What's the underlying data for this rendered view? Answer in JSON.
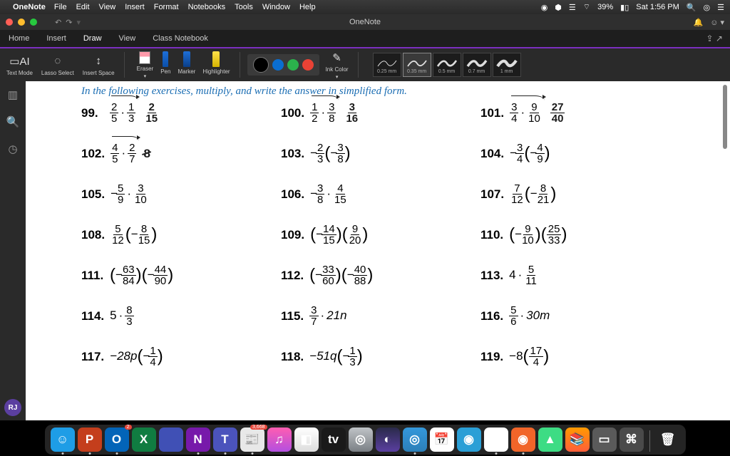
{
  "menubar": {
    "app": "OneNote",
    "items": [
      "File",
      "Edit",
      "View",
      "Insert",
      "Format",
      "Notebooks",
      "Tools",
      "Window",
      "Help"
    ],
    "battery": "39%",
    "time": "Sat 1:56 PM"
  },
  "titlebar": {
    "title": "OneNote"
  },
  "tabs": {
    "items": [
      "Home",
      "Insert",
      "Draw",
      "View",
      "Class Notebook"
    ],
    "active": 2
  },
  "ribbon": {
    "tools": [
      {
        "label": "Text Mode"
      },
      {
        "label": "Lasso Select"
      },
      {
        "label": "Insert Space"
      }
    ],
    "pens": [
      {
        "label": "Eraser"
      },
      {
        "label": "Pen"
      },
      {
        "label": "Marker"
      },
      {
        "label": "Highlighter"
      }
    ],
    "inkcolor": "Ink Color",
    "strokes": [
      "0.25 mm",
      "0.35 mm",
      "0.5 mm",
      "0.7 mm",
      "1 mm"
    ],
    "stroke_sel": 1
  },
  "avatar": "RJ",
  "page": {
    "instruction": "In the following exercises, multiply, and write the answer in simplified form.",
    "problems": [
      {
        "n": "99.",
        "expr": [
          {
            "t": "f",
            "a": "2",
            "b": "5"
          },
          {
            "t": "d"
          },
          {
            "t": "f",
            "a": "1",
            "b": "3"
          }
        ],
        "arrow": true,
        "ans": {
          "a": "2",
          "b": "15"
        }
      },
      {
        "n": "100.",
        "expr": [
          {
            "t": "f",
            "a": "1",
            "b": "2"
          },
          {
            "t": "d"
          },
          {
            "t": "f",
            "a": "3",
            "b": "8"
          }
        ],
        "arrow": true,
        "ans": {
          "a": "3",
          "b": "16"
        }
      },
      {
        "n": "101.",
        "expr": [
          {
            "t": "f",
            "a": "3",
            "b": "4"
          },
          {
            "t": "d"
          },
          {
            "t": "f",
            "a": "9",
            "b": "10"
          }
        ],
        "arrow": true,
        "ans": {
          "a": "27",
          "b": "40"
        }
      },
      {
        "n": "102.",
        "expr": [
          {
            "t": "f",
            "a": "4",
            "b": "5"
          },
          {
            "t": "d"
          },
          {
            "t": "f",
            "a": "2",
            "b": "7"
          }
        ],
        "arrow": true,
        "ans_cross": "8"
      },
      {
        "n": "103.",
        "expr": [
          {
            "t": "m"
          },
          {
            "t": "f",
            "a": "2",
            "b": "3"
          },
          {
            "t": "p",
            "inner": [
              {
                "t": "m"
              },
              {
                "t": "f",
                "a": "3",
                "b": "8"
              }
            ]
          }
        ]
      },
      {
        "n": "104.",
        "expr": [
          {
            "t": "m"
          },
          {
            "t": "f",
            "a": "3",
            "b": "4"
          },
          {
            "t": "p",
            "inner": [
              {
                "t": "m"
              },
              {
                "t": "f",
                "a": "4",
                "b": "9"
              }
            ]
          }
        ]
      },
      {
        "n": "105.",
        "expr": [
          {
            "t": "m"
          },
          {
            "t": "f",
            "a": "5",
            "b": "9"
          },
          {
            "t": "d"
          },
          {
            "t": "f",
            "a": "3",
            "b": "10"
          }
        ]
      },
      {
        "n": "106.",
        "expr": [
          {
            "t": "m"
          },
          {
            "t": "f",
            "a": "3",
            "b": "8"
          },
          {
            "t": "d"
          },
          {
            "t": "f",
            "a": "4",
            "b": "15"
          }
        ]
      },
      {
        "n": "107.",
        "expr": [
          {
            "t": "f",
            "a": "7",
            "b": "12"
          },
          {
            "t": "p",
            "inner": [
              {
                "t": "m"
              },
              {
                "t": "f",
                "a": "8",
                "b": "21"
              }
            ]
          }
        ]
      },
      {
        "n": "108.",
        "expr": [
          {
            "t": "f",
            "a": "5",
            "b": "12"
          },
          {
            "t": "p",
            "inner": [
              {
                "t": "m"
              },
              {
                "t": "f",
                "a": "8",
                "b": "15"
              }
            ]
          }
        ]
      },
      {
        "n": "109.",
        "expr": [
          {
            "t": "p",
            "inner": [
              {
                "t": "m"
              },
              {
                "t": "f",
                "a": "14",
                "b": "15"
              }
            ]
          },
          {
            "t": "p",
            "inner": [
              {
                "t": "f",
                "a": "9",
                "b": "20"
              }
            ]
          }
        ]
      },
      {
        "n": "110.",
        "expr": [
          {
            "t": "p",
            "inner": [
              {
                "t": "m"
              },
              {
                "t": "f",
                "a": "9",
                "b": "10"
              }
            ]
          },
          {
            "t": "p",
            "inner": [
              {
                "t": "f",
                "a": "25",
                "b": "33"
              }
            ]
          }
        ]
      },
      {
        "n": "111.",
        "expr": [
          {
            "t": "p",
            "inner": [
              {
                "t": "m"
              },
              {
                "t": "f",
                "a": "63",
                "b": "84"
              }
            ]
          },
          {
            "t": "p",
            "inner": [
              {
                "t": "m"
              },
              {
                "t": "f",
                "a": "44",
                "b": "90"
              }
            ]
          }
        ]
      },
      {
        "n": "112.",
        "expr": [
          {
            "t": "p",
            "inner": [
              {
                "t": "m"
              },
              {
                "t": "f",
                "a": "33",
                "b": "60"
              }
            ]
          },
          {
            "t": "p",
            "inner": [
              {
                "t": "m"
              },
              {
                "t": "f",
                "a": "40",
                "b": "88"
              }
            ]
          }
        ]
      },
      {
        "n": "113.",
        "expr": [
          {
            "t": "x",
            "v": "4"
          },
          {
            "t": "d"
          },
          {
            "t": "f",
            "a": "5",
            "b": "11"
          }
        ]
      },
      {
        "n": "114.",
        "expr": [
          {
            "t": "x",
            "v": "5"
          },
          {
            "t": "d"
          },
          {
            "t": "f",
            "a": "8",
            "b": "3"
          }
        ]
      },
      {
        "n": "115.",
        "expr": [
          {
            "t": "f",
            "a": "3",
            "b": "7"
          },
          {
            "t": "d"
          },
          {
            "t": "x",
            "v": "21n",
            "it": true
          }
        ]
      },
      {
        "n": "116.",
        "expr": [
          {
            "t": "f",
            "a": "5",
            "b": "6"
          },
          {
            "t": "d"
          },
          {
            "t": "x",
            "v": "30m",
            "it": true
          }
        ]
      },
      {
        "n": "117.",
        "expr": [
          {
            "t": "x",
            "v": "−28p",
            "it": true
          },
          {
            "t": "p",
            "inner": [
              {
                "t": "m"
              },
              {
                "t": "f",
                "a": "1",
                "b": "4"
              }
            ]
          }
        ]
      },
      {
        "n": "118.",
        "expr": [
          {
            "t": "x",
            "v": "−51q",
            "it": true
          },
          {
            "t": "p",
            "inner": [
              {
                "t": "m"
              },
              {
                "t": "f",
                "a": "1",
                "b": "3"
              }
            ]
          }
        ]
      },
      {
        "n": "119.",
        "expr": [
          {
            "t": "x",
            "v": "−8"
          },
          {
            "t": "p",
            "inner": [
              {
                "t": "f",
                "a": "17",
                "b": "4"
              }
            ]
          }
        ]
      }
    ]
  },
  "dock": {
    "icons": [
      {
        "bg": "#1e9de6",
        "ch": "☺",
        "dot": true
      },
      {
        "bg": "#c43e1c",
        "ch": "P",
        "dot": true
      },
      {
        "bg": "#0364b8",
        "ch": "O",
        "dot": true,
        "badge": "2"
      },
      {
        "bg": "#107c41",
        "ch": "X"
      },
      {
        "bg": "#4050b5",
        "ch": ""
      },
      {
        "bg": "#7719aa",
        "ch": "N",
        "dot": true
      },
      {
        "bg": "#4b53bc",
        "ch": "T",
        "dot": true
      },
      {
        "bg": "#e8e8e8",
        "ch": "📰",
        "badge": "3,668",
        "dot": true
      },
      {
        "bg": "linear-gradient(#ff5db1,#b34fe0)",
        "ch": "♫"
      },
      {
        "bg": "linear-gradient(#fff,#ddd)",
        "ch": "◧"
      },
      {
        "bg": "#1a1a1a",
        "ch": "tv"
      },
      {
        "bg": "linear-gradient(#bfc3c7,#7a7f84)",
        "ch": "◎"
      },
      {
        "bg": "linear-gradient(#2a2a4a,#5a3fa0)",
        "ch": "◐"
      },
      {
        "bg": "linear-gradient(#3498db,#2c7fb8)",
        "ch": "◎",
        "dot": true
      },
      {
        "bg": "#fff",
        "ch": "📅"
      },
      {
        "bg": "#2a9fd6",
        "ch": "◉"
      },
      {
        "bg": "#fff",
        "ch": "◯",
        "dot": true
      },
      {
        "bg": "#f16529",
        "ch": "◉",
        "dot": true
      },
      {
        "bg": "#3ddc84",
        "ch": "▲"
      },
      {
        "bg": "linear-gradient(#ff9a00,#ff5e3a)",
        "ch": "📚"
      },
      {
        "bg": "#5a5a5a",
        "ch": "▭"
      },
      {
        "bg": "#4a4a4a",
        "ch": "⌘"
      },
      {
        "bg": "transparent",
        "ch": "🗑"
      }
    ]
  }
}
